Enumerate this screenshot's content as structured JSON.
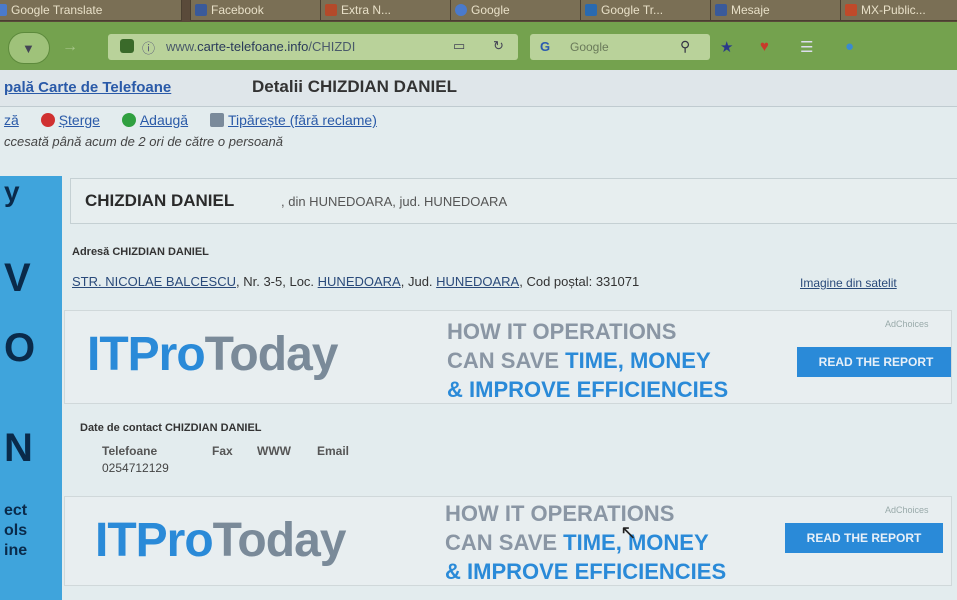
{
  "browser": {
    "tabs": [
      {
        "label": "Google Translate",
        "color": "#4a7acc"
      },
      {
        "label": "Facebook",
        "color": "#3a5a9a"
      },
      {
        "label": "Extra N...",
        "color": "#b44a2a"
      },
      {
        "label": "Google",
        "color": "#4a7acc"
      },
      {
        "label": "Google Tr...",
        "color": "#2a6ab0"
      },
      {
        "label": "Mesaje",
        "color": "#3a5a9a"
      },
      {
        "label": "MX-Public...",
        "color": "#c04a2a"
      }
    ],
    "url_prefix": "www.",
    "url_domain": "carte-telefoane.info",
    "url_path": "/CHIZDI",
    "search_engine": "G",
    "search_placeholder": "Google",
    "toolbar_icons": [
      "bookmark-star-icon",
      "pocket-icon",
      "menu-icon",
      "extension-icon"
    ]
  },
  "page": {
    "breadcrumb": "pală Carte de Telefoane",
    "title": "Detalii CHIZDIAN DANIEL",
    "actions": [
      {
        "label": "ză",
        "icon": "edit-icon",
        "color": "#c03030"
      },
      {
        "label": "Șterge",
        "icon": "delete-icon",
        "color": "#d03030"
      },
      {
        "label": "Adaugă",
        "icon": "add-icon",
        "color": "#30a040"
      },
      {
        "label": "Tipărește (fără reclame)",
        "icon": "print-icon",
        "color": "#7a8a9a"
      }
    ],
    "accessed_text": "ccesată până acum de 2 ori de către o persoană",
    "person": {
      "name": "CHIZDIAN DANIEL",
      "from_text": ", din HUNEDOARA, jud. HUNEDOARA"
    },
    "address": {
      "label": "Adresă CHIZDIAN DANIEL",
      "street": "STR. NICOLAE BALCESCU",
      "number_text": ", Nr. 3-5, Loc. ",
      "locality": "HUNEDOARA",
      "county_prefix": ", Jud. ",
      "county": "HUNEDOARA",
      "postal_text": ", Cod poștal: 331071",
      "satellite_link": "Imagine din satelit"
    },
    "contact": {
      "label": "Date de contact CHIZDIAN DANIEL",
      "columns": [
        "Telefoane",
        "Fax",
        "WWW",
        "Email"
      ],
      "phone": "0254712129"
    },
    "ads": [
      {
        "brand_it": "ITPro",
        "brand_today": "Today",
        "line1": "HOW IT OPERATIONS",
        "line2_a": "CAN SAVE ",
        "line2_b": "TIME, MONEY",
        "line3": "& IMPROVE EFFICIENCIES",
        "cta": "READ THE REPORT",
        "choices": "AdChoices"
      },
      {
        "brand_it": "ITPro",
        "brand_today": "Today",
        "line1": "HOW IT OPERATIONS",
        "line2_a": "CAN SAVE ",
        "line2_b": "TIME, MONEY",
        "line3": "& IMPROVE EFFICIENCIES",
        "cta": "READ THE REPORT",
        "choices": "AdChoices"
      }
    ],
    "left_strip_text": [
      "y",
      "V",
      "O",
      "N",
      "ect",
      "ols",
      "ine"
    ]
  }
}
